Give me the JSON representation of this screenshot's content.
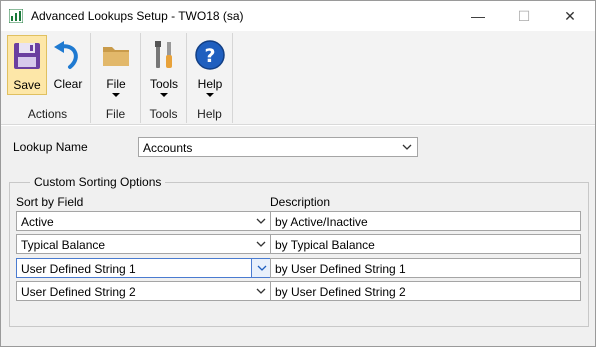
{
  "window": {
    "title": "Advanced Lookups Setup  -  TWO18 (sa)",
    "minimize_glyph": "—",
    "maximize_glyph": "☐",
    "close_glyph": "✕"
  },
  "ribbon": {
    "groups": [
      {
        "label": "Actions",
        "buttons": [
          {
            "label": "Save",
            "icon": "save-disk-icon",
            "active": true
          },
          {
            "label": "Clear",
            "icon": "undo-arrow-icon"
          }
        ]
      },
      {
        "label": "File",
        "buttons": [
          {
            "label": "File",
            "icon": "folder-icon",
            "dropdown": true
          }
        ]
      },
      {
        "label": "Tools",
        "buttons": [
          {
            "label": "Tools",
            "icon": "tools-icon",
            "dropdown": true
          }
        ]
      },
      {
        "label": "Help",
        "buttons": [
          {
            "label": "Help",
            "icon": "help-icon",
            "dropdown": true
          }
        ]
      }
    ]
  },
  "form": {
    "lookup_name_label": "Lookup Name",
    "lookup_name_value": "Accounts",
    "custom_sorting": {
      "title": "Custom Sorting Options",
      "sort_by_field_header": "Sort by Field",
      "description_header": "Description",
      "rows": [
        {
          "field": "Active",
          "description": "by Active/Inactive"
        },
        {
          "field": "Typical Balance",
          "description": "by Typical Balance"
        },
        {
          "field": "User Defined String 1",
          "description": "by User Defined String 1"
        },
        {
          "field": "User Defined String 2",
          "description": "by User Defined String 2"
        }
      ]
    }
  },
  "colors": {
    "accent_blue": "#1f5fbf",
    "save_active_bg": "#fde7a8",
    "ribbon_bg": "#f3f3f3",
    "content_bg": "#f0f0f0"
  }
}
